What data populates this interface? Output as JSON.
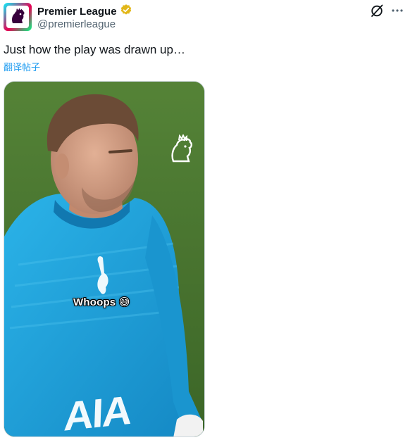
{
  "author": {
    "display_name": "Premier League",
    "handle": "@premierleague",
    "verified": true,
    "verified_badge_color": "#e2b719",
    "avatar_icon": "premier-league-lion-icon"
  },
  "actions": {
    "grok_icon": "grok-icon",
    "more_icon": "more-horizontal-icon"
  },
  "tweet": {
    "text": "Just how the play was drawn up…",
    "translate_label": "翻译帖子"
  },
  "media": {
    "type": "video",
    "caption": "Whoops 😅",
    "kit_sponsor_text": "AIA",
    "watermark_icon": "premier-league-lion-icon",
    "pitch_color": "#4c7a32",
    "kit_color": "#1ea3d8"
  },
  "colors": {
    "link": "#1d9bf0",
    "text_primary": "#0f1419",
    "text_secondary": "#536471"
  }
}
